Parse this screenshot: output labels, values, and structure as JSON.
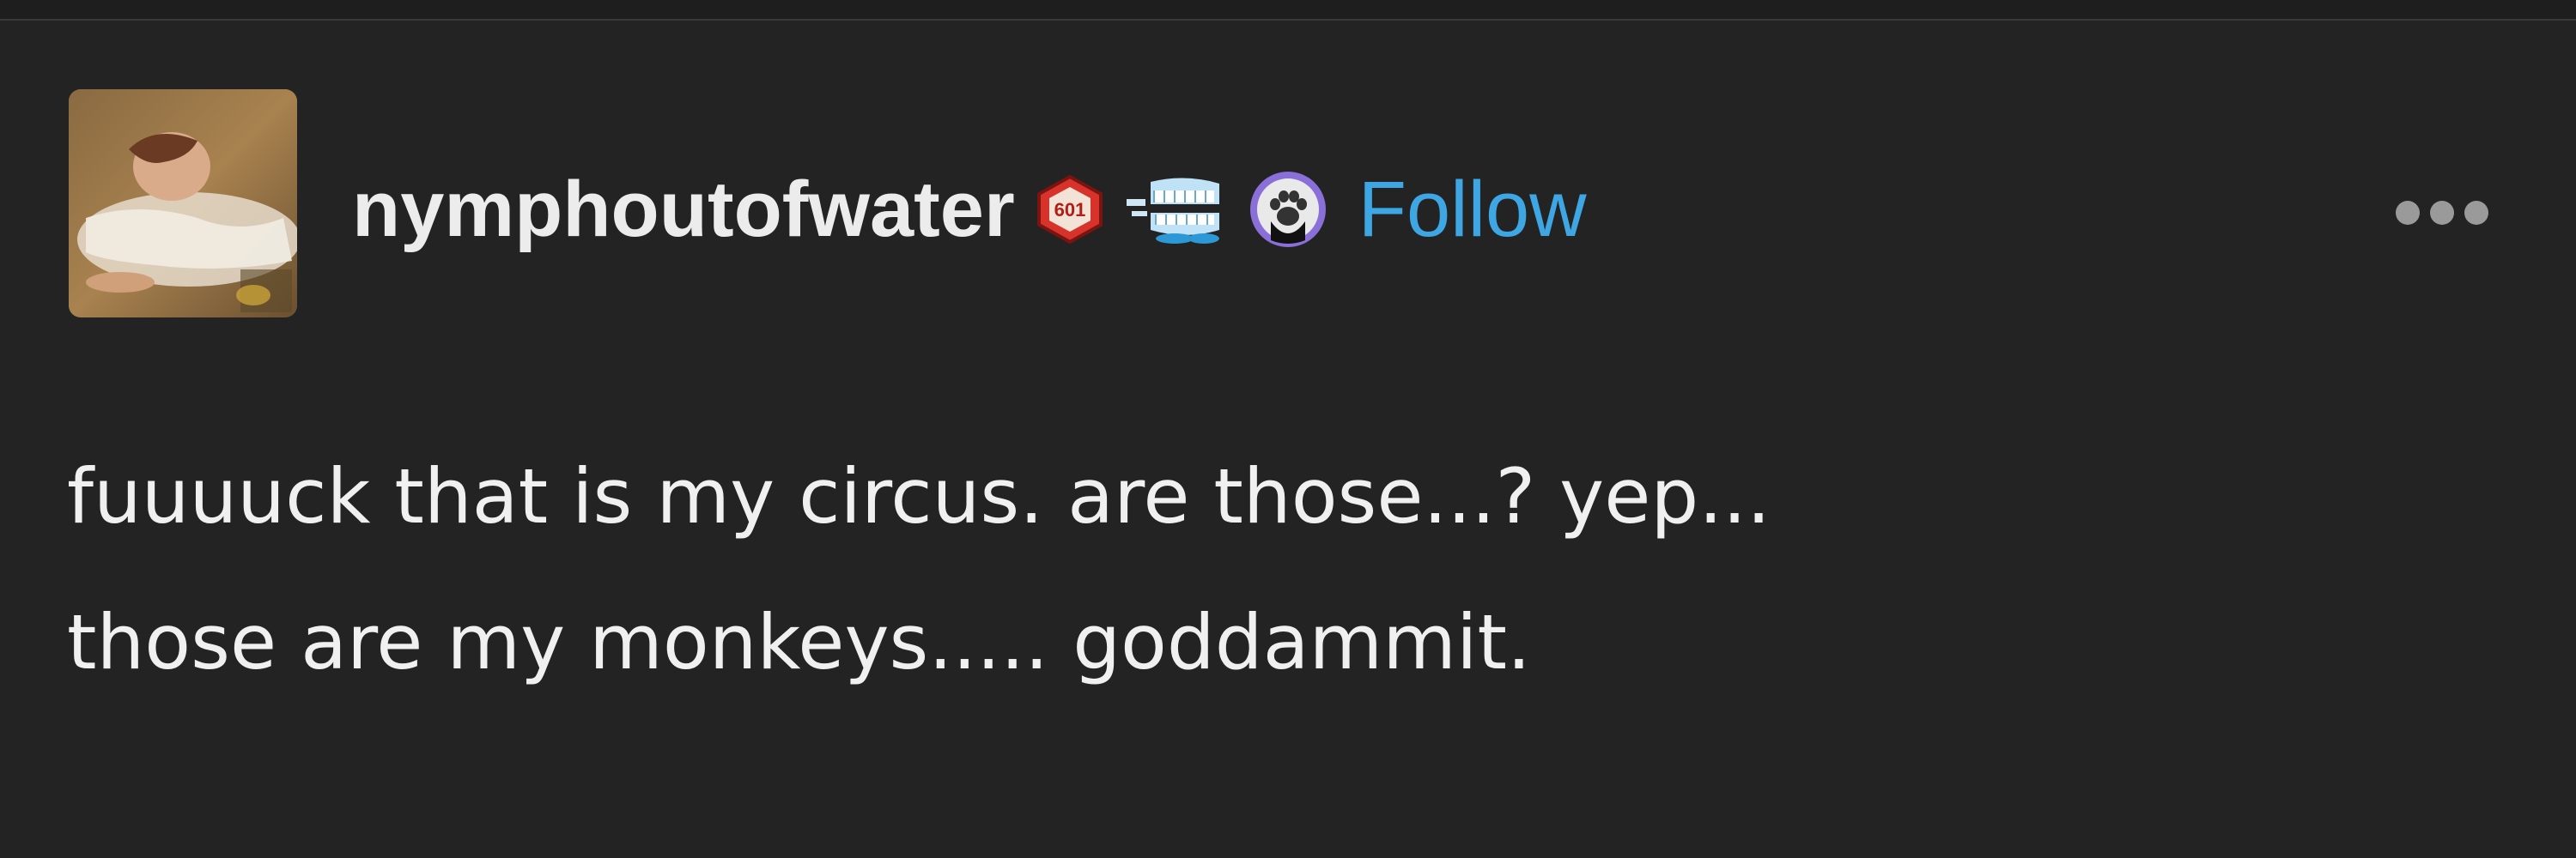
{
  "post": {
    "username": "nymphoutofwater",
    "follow_label": "Follow",
    "level_badge": "601",
    "body_lines": [
      "fuuuuck that is my circus. are those...? yep...",
      "those are my monkeys..... goddammit."
    ]
  },
  "icons": {
    "avatar": "avatar-painting",
    "level_badge": "level-badge-icon",
    "teeth": "chattering-teeth-icon",
    "paw": "paw-icon",
    "more": "more-options-icon"
  },
  "colors": {
    "background": "#232323",
    "text": "#f0f0f0",
    "follow": "#3fa6e4",
    "badge_red": "#d7332b"
  }
}
